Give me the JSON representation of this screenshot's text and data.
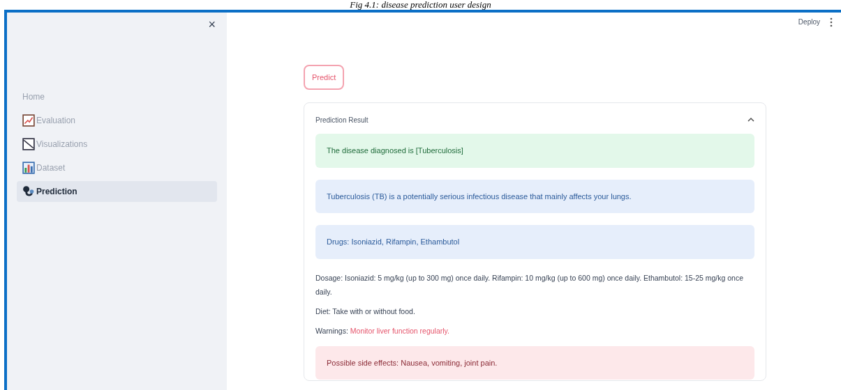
{
  "caption": "Fig 4.1: disease prediction user design",
  "sidebar": {
    "close": "×",
    "items": [
      {
        "label": "Home",
        "selected": false
      },
      {
        "label": "Evaluation",
        "selected": false
      },
      {
        "label": "Visualizations",
        "selected": false
      },
      {
        "label": "Dataset",
        "selected": false
      },
      {
        "label": "Prediction",
        "selected": true
      }
    ]
  },
  "header": {
    "deploy": "Deploy"
  },
  "predict_button": "Predict",
  "expander": {
    "title": "Prediction Result",
    "expanded": true,
    "blocks": [
      {
        "kind": "success",
        "text": "The disease diagnosed is [Tuberculosis]"
      },
      {
        "kind": "info",
        "text": "Tuberculosis (TB) is a potentially serious infectious disease that mainly affects your lungs."
      },
      {
        "kind": "info",
        "text": "Drugs: Isoniazid, Rifampin, Ethambutol"
      },
      {
        "kind": "text",
        "text": "Dosage: Isoniazid: 5 mg/kg (up to 300 mg) once daily. Rifampin: 10 mg/kg (up to 600 mg) once daily. Ethambutol: 15-25 mg/kg once daily."
      },
      {
        "kind": "text",
        "text": "Diet: Take with or without food."
      },
      {
        "kind": "warning",
        "label": "Warnings:",
        "text": "Monitor liver function regularly."
      },
      {
        "kind": "error",
        "text": "Possible side effects: Nausea, vomiting, joint pain."
      }
    ]
  }
}
